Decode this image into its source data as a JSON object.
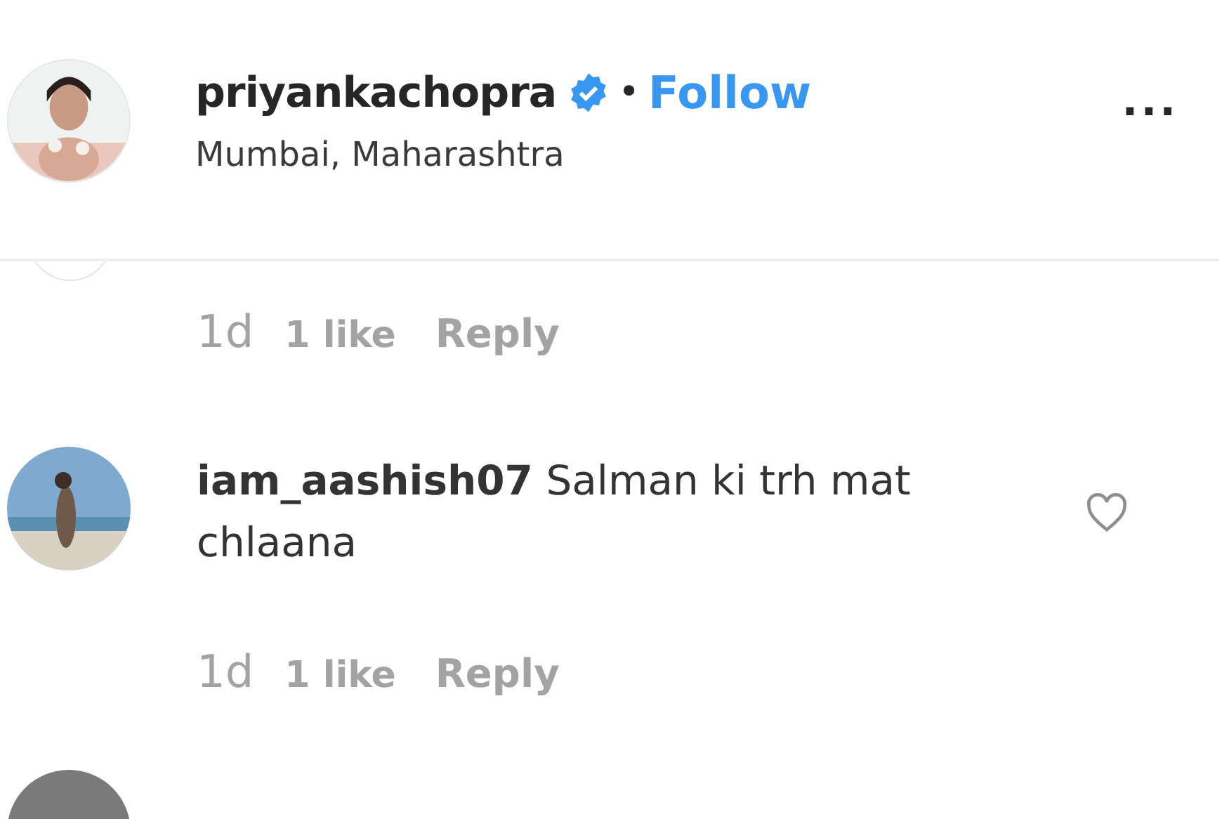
{
  "header": {
    "username": "priyankachopra",
    "verified": true,
    "separator": "•",
    "follow": "Follow",
    "location": "Mumbai, Maharashtra",
    "more": "..."
  },
  "comments": [
    {
      "kind": "meta_only",
      "time": "1d",
      "likes": "1 like",
      "reply": "Reply"
    },
    {
      "kind": "full",
      "username": "iam_aashish07",
      "text": "Salman ki trh mat chlaana",
      "liked": false,
      "time": "1d",
      "likes": "1 like",
      "reply": "Reply"
    },
    {
      "kind": "avatar_only"
    }
  ]
}
